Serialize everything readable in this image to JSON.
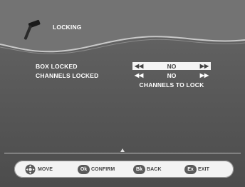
{
  "header": {
    "title": "LOCKING",
    "icon": "hammer-icon"
  },
  "settings": [
    {
      "label": "BOX LOCKED",
      "value": "NO",
      "active": true
    },
    {
      "label": "CHANNELS LOCKED",
      "value": "NO",
      "active": false
    }
  ],
  "sub_action": {
    "label": "CHANNELS TO LOCK"
  },
  "footer": {
    "move": {
      "label": "MOVE",
      "icon": "dpad-icon"
    },
    "confirm": {
      "badge": "Ok",
      "label": "CONFIRM"
    },
    "back": {
      "badge": "Bk",
      "label": "BACK"
    },
    "exit": {
      "badge": "Ex",
      "label": "EXIT"
    }
  },
  "colors": {
    "background": "#5e5e5e",
    "highlight": "#f4f4f4",
    "text": "#ffffff"
  }
}
